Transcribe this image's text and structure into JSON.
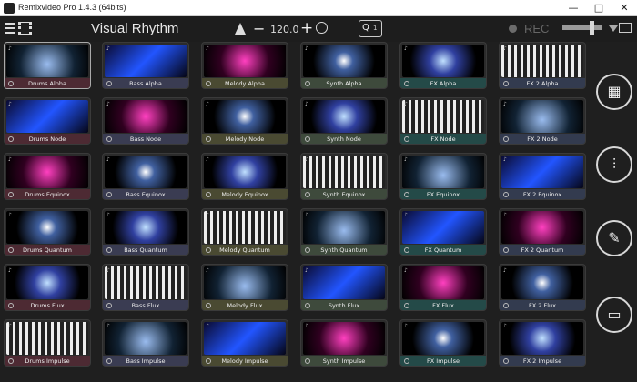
{
  "window": {
    "title": "Remixvideo Pro 1.4.3 (64bits)",
    "minimize": "—",
    "maximize": "□",
    "close": "✕"
  },
  "toolbar": {
    "title": "Visual Rhythm",
    "bpm": "120.0",
    "minus": "−",
    "plus": "+",
    "quantize_label": "Q",
    "quantize_value": "1",
    "rec_label": "REC"
  },
  "rows": [
    [
      "Drums Alpha",
      "Bass Alpha",
      "Melody Alpha",
      "Synth Alpha",
      "FX Alpha",
      "FX 2 Alpha"
    ],
    [
      "Drums Node",
      "Bass Node",
      "Melody Node",
      "Synth Node",
      "FX Node",
      "FX 2 Node"
    ],
    [
      "Drums Equinox",
      "Bass Equinox",
      "Melody Equinox",
      "Synth Equinox",
      "FX Equinox",
      "FX 2 Equinox"
    ],
    [
      "Drums Quantum",
      "Bass Quantum",
      "Melody Quantum",
      "Synth Quantum",
      "FX Quantum",
      "FX 2 Quantum"
    ],
    [
      "Drums Flux",
      "Bass Flux",
      "Melody Flux",
      "Synth Flux",
      "FX Flux",
      "FX 2 Flux"
    ],
    [
      "Drums Impulse",
      "Bass Impulse",
      "Melody Impulse",
      "Synth Impulse",
      "FX Impulse",
      "FX 2 Impulse"
    ]
  ],
  "sidebar": {
    "icons": [
      "grid-icon",
      "mixer-icon",
      "edit-icon",
      "folder-icon"
    ]
  }
}
